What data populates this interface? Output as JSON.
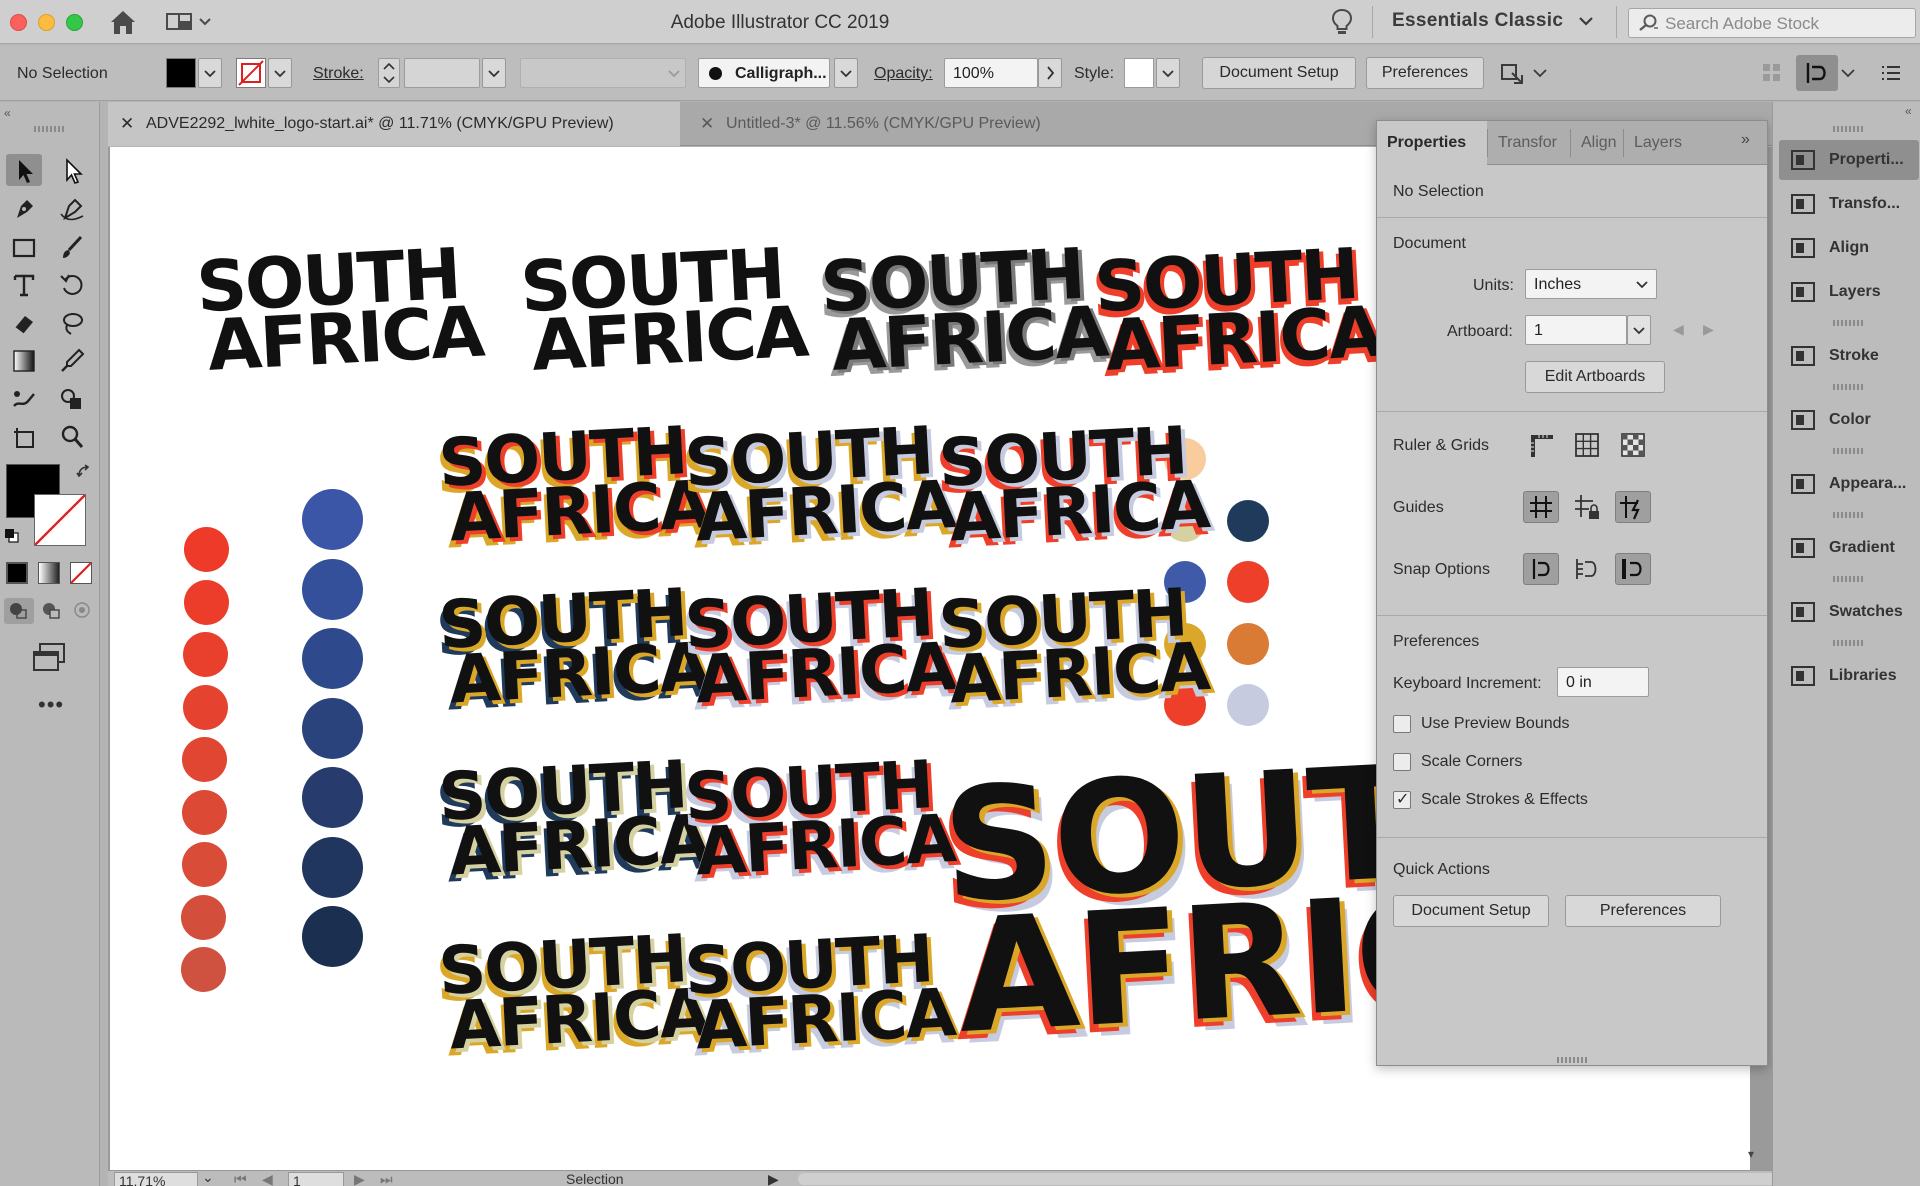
{
  "app": {
    "title": "Adobe Illustrator CC 2019",
    "workspace": "Essentials Classic",
    "search_placeholder": "Search Adobe Stock"
  },
  "control_bar": {
    "selection_label": "No Selection",
    "stroke_label": "Stroke:",
    "brush_value": "Calligraph...",
    "opacity_label": "Opacity:",
    "opacity_value": "100%",
    "style_label": "Style:",
    "document_setup": "Document Setup",
    "preferences": "Preferences"
  },
  "tabs": [
    {
      "label": "ADVE2292_lwhite_logo-start.ai* @ 11.71% (CMYK/GPU Preview)",
      "close": "✕"
    },
    {
      "label": "Untitled-3* @ 11.56% (CMYK/GPU Preview)",
      "close": "✕"
    }
  ],
  "properties_panel": {
    "tabs": [
      "Properties",
      "Transfor",
      "Align",
      "Layers"
    ],
    "no_selection": "No Selection",
    "document_heading": "Document",
    "units_label": "Units:",
    "units_value": "Inches",
    "artboard_label": "Artboard:",
    "artboard_value": "1",
    "edit_artboards": "Edit Artboards",
    "ruler_grids": "Ruler & Grids",
    "guides": "Guides",
    "snap_options": "Snap Options",
    "preferences_heading": "Preferences",
    "keyboard_increment_label": "Keyboard Increment:",
    "keyboard_increment_value": "0 in",
    "use_preview_bounds": "Use Preview Bounds",
    "scale_corners": "Scale Corners",
    "scale_strokes": "Scale Strokes & Effects",
    "quick_actions": "Quick Actions",
    "document_setup": "Document Setup",
    "preferences": "Preferences"
  },
  "dock": [
    {
      "label": "Properti...",
      "icon": "properties-icon"
    },
    {
      "label": "Transfo...",
      "icon": "transform-icon"
    },
    {
      "label": "Align",
      "icon": "align-icon"
    },
    {
      "label": "Layers",
      "icon": "layers-icon"
    },
    {
      "label": "Stroke",
      "icon": "stroke-icon"
    },
    {
      "label": "Color",
      "icon": "color-icon"
    },
    {
      "label": "Appeara...",
      "icon": "appearance-icon"
    },
    {
      "label": "Gradient",
      "icon": "gradient-icon"
    },
    {
      "label": "Swatches",
      "icon": "swatches-icon"
    },
    {
      "label": "Libraries",
      "icon": "libraries-icon"
    }
  ],
  "status_bar": {
    "zoom": "11.71%",
    "artboard": "1",
    "tool": "Selection"
  },
  "artwork": {
    "line1": "SOUTH",
    "line2": "AFRICA"
  },
  "colors": {
    "red": "#ee3f2a",
    "navy": "#1f3a5a",
    "blue": "#3e5aa8",
    "gold": "#dba728",
    "orange": "#d97a35",
    "peach": "#f8cc9c",
    "khaki": "#d6d1a0",
    "lavender": "#c7cbe0",
    "gray": "#7a7a7a"
  }
}
